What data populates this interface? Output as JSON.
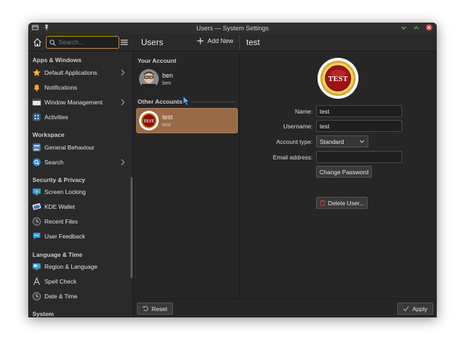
{
  "window": {
    "title": "Users — System Settings"
  },
  "toolbar": {
    "search_placeholder": "Search...",
    "section_title": "Users",
    "add_new_label": "Add New",
    "page_title": "test"
  },
  "sidebar": {
    "headers": {
      "apps_windows": "Apps & Windows",
      "workspace": "Workspace",
      "security_privacy": "Security & Privacy",
      "language_time": "Language & Time",
      "system": "System"
    },
    "items": {
      "default_apps": "Default Applications",
      "notifications": "Notifications",
      "window_management": "Window Management",
      "activities": "Activities",
      "general_behaviour": "General Behaviour",
      "search": "Search",
      "screen_locking": "Screen Locking",
      "kde_wallet": "KDE Wallet",
      "recent_files": "Recent Files",
      "user_feedback": "User Feedback",
      "region_language": "Region & Language",
      "spell_check": "Spell Check",
      "date_time": "Date & Time"
    }
  },
  "users": {
    "your_account_header": "Your Account",
    "other_accounts_header": "Other Accounts",
    "current": {
      "name": "ben",
      "login": "ben"
    },
    "other": {
      "name": "test",
      "login": "test"
    }
  },
  "avatar_text": "TEST",
  "form": {
    "name_label": "Name:",
    "name_value": "test",
    "username_label": "Username:",
    "username_value": "test",
    "account_type_label": "Account type:",
    "account_type_value": "Standard",
    "email_label": "Email address:",
    "email_value": "",
    "change_password_label": "Change Password",
    "delete_user_label": "Delete User..."
  },
  "footer": {
    "reset_label": "Reset",
    "apply_label": "Apply"
  },
  "colors": {
    "accent": "#d08a2e",
    "selection": "#9a6a46",
    "danger": "#d04040"
  }
}
